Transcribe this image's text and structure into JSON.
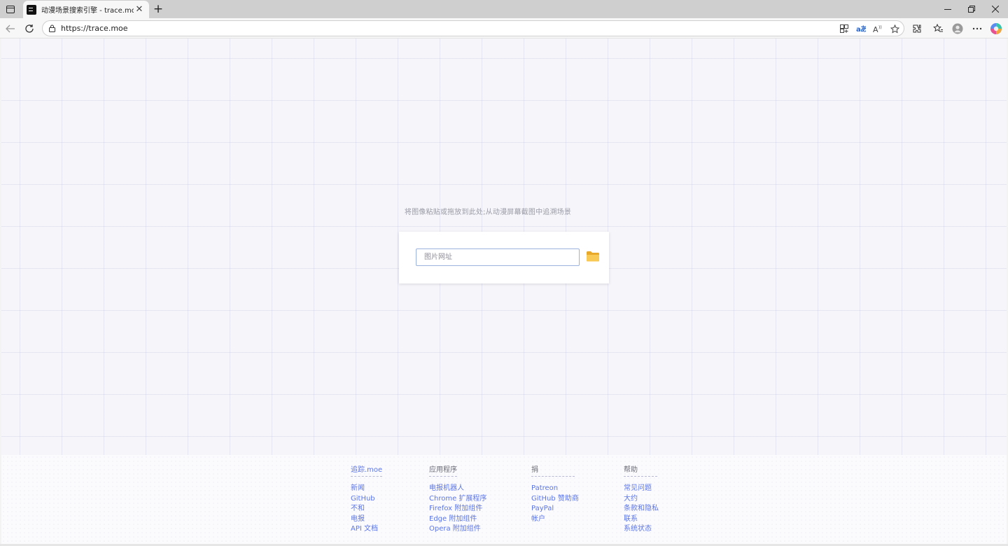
{
  "browser": {
    "tab_title": "动漫场景搜索引擎 - trace.moe",
    "url": "https://trace.moe",
    "new_tab_symbol": "+",
    "close_symbol": "✕"
  },
  "main": {
    "hint": "将图像粘贴或拖放到此处;从动漫屏幕截图中追溯场景",
    "url_input_placeholder": "图片网址"
  },
  "footer": {
    "columns": [
      {
        "title": "追踪.moe",
        "items": [
          "新闻",
          "GitHub",
          "不和",
          "电报",
          "API 文档"
        ]
      },
      {
        "title": "应用程序",
        "items": [
          "电报机器人",
          "Chrome 扩展程序",
          "Firefox 附加组件",
          "Edge 附加组件",
          "Opera 附加组件"
        ]
      },
      {
        "title": "捐",
        "items": [
          "Patreon",
          "GitHub 赞助商",
          "PayPal",
          "帐户"
        ]
      },
      {
        "title": "帮助",
        "items": [
          "常见问题",
          "大约",
          "条款和隐私",
          "联系",
          "系统状态"
        ]
      }
    ]
  },
  "colors": {
    "link": "#5b75e8",
    "folder": "#f6c24a"
  }
}
